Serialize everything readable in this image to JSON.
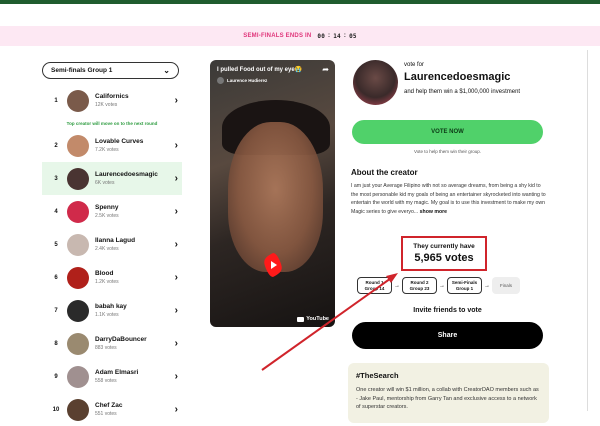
{
  "countdown": {
    "label": "SEMI-FINALS ENDS IN",
    "hours": "00",
    "minutes": "14",
    "seconds": "05"
  },
  "group_select": {
    "value": "Semi-finals Group 1"
  },
  "advance_note": "Top creator will move on to the next round",
  "creators": [
    {
      "rank": "1",
      "name": "Californics",
      "votes": "12K votes",
      "color": "#7a5a4a"
    },
    {
      "rank": "2",
      "name": "Lovable Curves",
      "votes": "7.2K votes",
      "color": "#c28a6a"
    },
    {
      "rank": "3",
      "name": "Laurencedoesmagic",
      "votes": "6K votes",
      "color": "#4a3432"
    },
    {
      "rank": "4",
      "name": "Spenny",
      "votes": "2.5K votes",
      "color": "#d02a4a"
    },
    {
      "rank": "5",
      "name": "Ilanna Lagud",
      "votes": "2.4K votes",
      "color": "#c8b8b0"
    },
    {
      "rank": "6",
      "name": "Blood",
      "votes": "1.2K votes",
      "color": "#b0201a"
    },
    {
      "rank": "7",
      "name": "babah kay",
      "votes": "1.1K votes",
      "color": "#2a2a2a"
    },
    {
      "rank": "8",
      "name": "DarryDaBouncer",
      "votes": "883 votes",
      "color": "#9a8a70"
    },
    {
      "rank": "9",
      "name": "Adam Elmasri",
      "votes": "558 votes",
      "color": "#a09090"
    },
    {
      "rank": "10",
      "name": "Chef Zac",
      "votes": "551 votes",
      "color": "#5a4030"
    }
  ],
  "video": {
    "title": "I pulled Food out of my eye😭",
    "channel": "Laurence Hudierez",
    "brand": "YouTube"
  },
  "creator": {
    "vote_for": "vote for",
    "name": "Laurencedoesmagic",
    "subtitle": "and help them win a $1,000,000 investment"
  },
  "vote_button": "VOTE NOW",
  "vote_hint": "Vote to help them win their group.",
  "about": {
    "heading": "About the creator",
    "text": "I am just your Average Filipino with not so average dreams, from being a shy kid to the most personable kid my goals of being an entertainer skyrocketed into wanting to entertain the world with my magic. My goal is to use this investment to make my own Magic series to give everyo...",
    "more": "show more"
  },
  "current_votes": {
    "label": "They currently have",
    "value": "5,965 votes"
  },
  "rounds": [
    "Round 1 Group 14",
    "Round 2 Group 23",
    "Semi-Finals Group 1",
    "Finals"
  ],
  "invite": "Invite friends to vote",
  "share_button": "Share",
  "search_card": {
    "heading": "#TheSearch",
    "text": "One creator will win $1 million, a collab with CreatorDAO members such as - Jake Paul, mentorship from Garry Tan and exclusive access to a network of superstar creators."
  },
  "colors": {
    "accent_green": "#50d16a",
    "highlight_red": "#d0242b",
    "banner_pink": "#fde8f3",
    "top_bar": "#1f5c2e"
  }
}
